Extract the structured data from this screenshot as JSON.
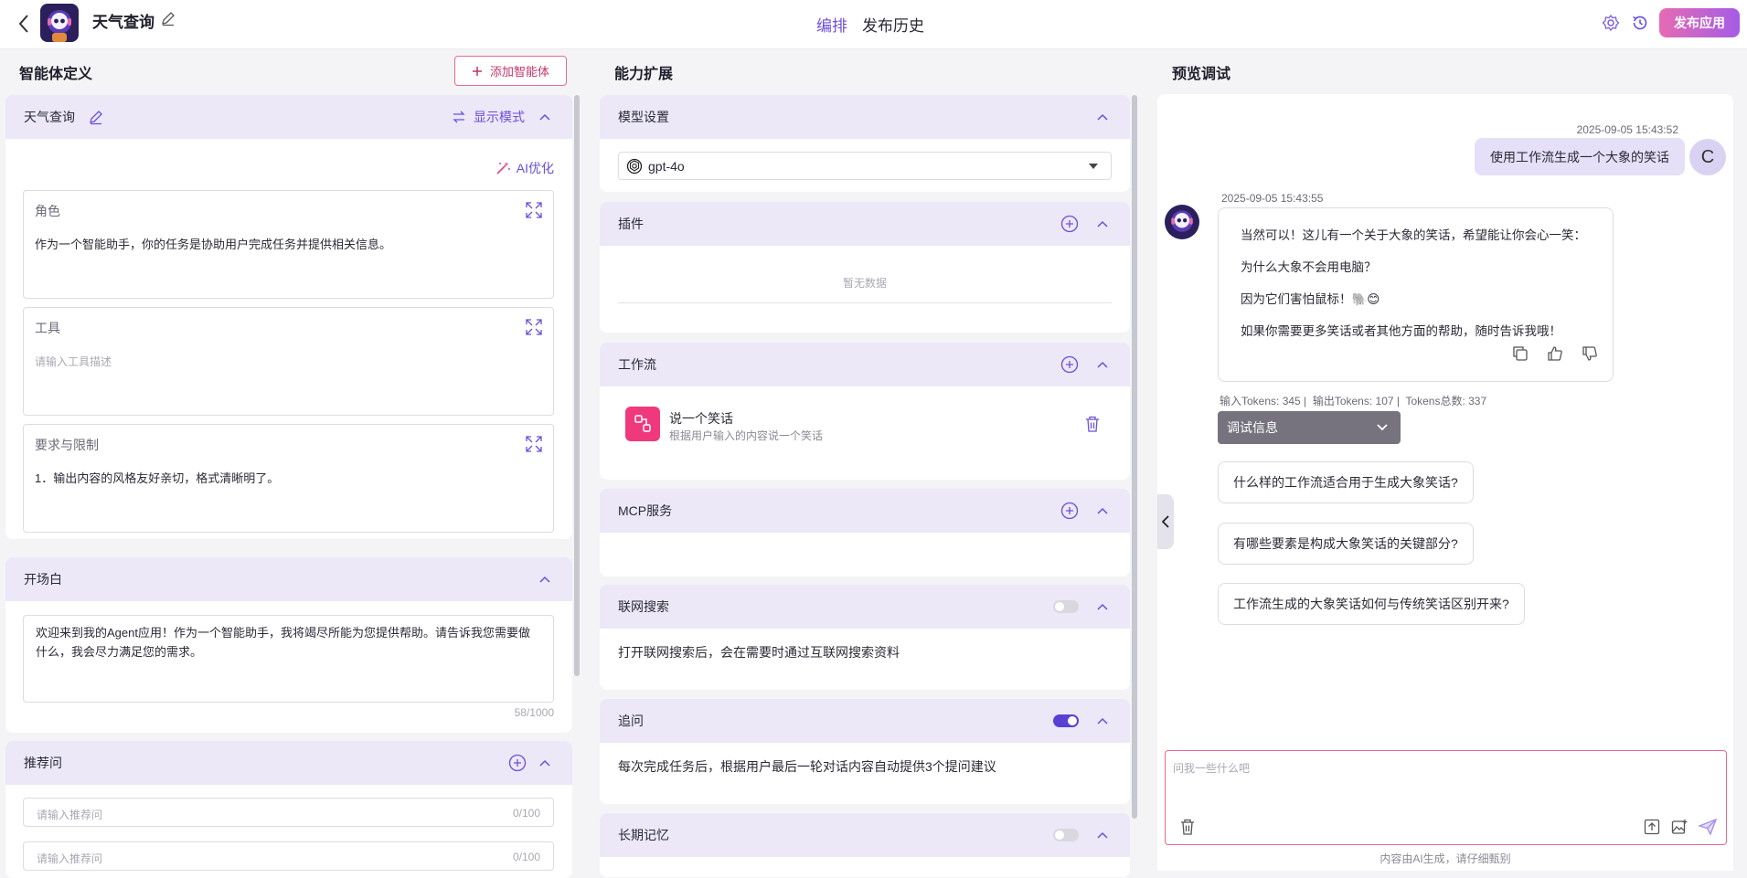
{
  "header": {
    "app_title": "天气查询",
    "tabs": [
      {
        "label": "编排",
        "active": true
      },
      {
        "label": "发布历史",
        "active": false
      }
    ],
    "publish_label": "发布应用",
    "accent": "#6c4ed9"
  },
  "left": {
    "title": "智能体定义",
    "add_agent_label": "添加智能体",
    "agent_name": "天气查询",
    "display_mode_label": "显示模式",
    "ai_optimize_label": "AI优化",
    "role": {
      "label": "角色",
      "value": "作为一个智能助手，你的任务是协助用户完成任务并提供相关信息。"
    },
    "tools": {
      "label": "工具",
      "placeholder": "请输入工具描述"
    },
    "constraints": {
      "label": "要求与限制",
      "value": "1．输出内容的风格友好亲切，格式清晰明了。"
    },
    "opening": {
      "title": "开场白",
      "value": "欢迎来到我的Agent应用！作为一个智能助手，我将竭尽所能为您提供帮助。请告诉我您需要做什么，我会尽力满足您的需求。",
      "counter": "58/1000"
    },
    "suggest": {
      "title": "推荐问",
      "inputs": [
        {
          "placeholder": "请输入推荐问",
          "counter": "0/100"
        },
        {
          "placeholder": "请输入推荐问",
          "counter": "0/100"
        }
      ]
    }
  },
  "middle": {
    "title": "能力扩展",
    "model": {
      "title": "模型设置",
      "selected": "gpt-4o"
    },
    "plugins": {
      "title": "插件",
      "empty": "暂无数据"
    },
    "workflow": {
      "title": "工作流",
      "items": [
        {
          "name": "说一个笑话",
          "desc": "根据用户输入的内容说一个笑话"
        }
      ]
    },
    "mcp": {
      "title": "MCP服务"
    },
    "web_search": {
      "title": "联网搜索",
      "enabled": false,
      "desc": "打开联网搜索后，会在需要时通过互联网搜索资料"
    },
    "follow_up": {
      "title": "追问",
      "enabled": true,
      "desc": "每次完成任务后，根据用户最后一轮对话内容自动提供3个提问建议"
    },
    "long_memory": {
      "title": "长期记忆",
      "enabled": false
    }
  },
  "right": {
    "title": "预览调试",
    "user_msg": {
      "time": "2025-09-05 15:43:52",
      "text": "使用工作流生成一个大象的笑话",
      "avatar_letter": "C"
    },
    "bot_msg": {
      "time": "2025-09-05 15:43:55",
      "lines": [
        "当然可以！这儿有一个关于大象的笑话，希望能让你会心一笑：",
        "为什么大象不会用电脑？",
        "因为它们害怕鼠标！🐘😊",
        "如果你需要更多笑话或者其他方面的帮助，随时告诉我哦！"
      ],
      "tokens": "输入Tokens: 345 |  输出Tokens: 107 |  Tokens总数: 337",
      "debug_label": "调试信息"
    },
    "suggestions": [
      "什么样的工作流适合用于生成大象笑话?",
      "有哪些要素是构成大象笑话的关键部分?",
      "工作流生成的大象笑话如何与传统笑话区别开来?"
    ],
    "input_placeholder": "问我一些什么吧",
    "footer_note": "内容由AI生成，请仔细甄别"
  }
}
